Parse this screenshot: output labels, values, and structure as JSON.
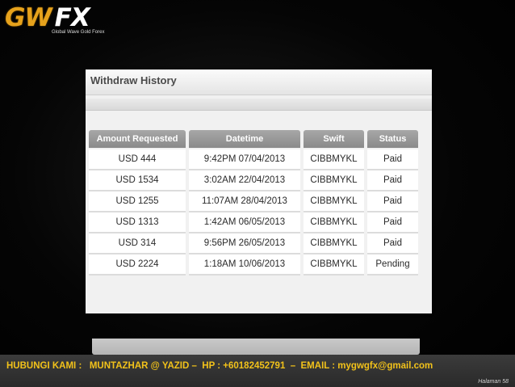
{
  "logo": {
    "brand_left": "GW",
    "brand_right": "FX",
    "tagline": "Global Wave Gold Forex"
  },
  "panel": {
    "title": "Withdraw History"
  },
  "table": {
    "headers": [
      "Amount Requested",
      "Datetime",
      "Swift",
      "Status"
    ],
    "rows": [
      [
        "USD 444",
        "9:42PM 07/04/2013",
        "CIBBMYKL",
        "Paid"
      ],
      [
        "USD 1534",
        "3:02AM 22/04/2013",
        "CIBBMYKL",
        "Paid"
      ],
      [
        "USD 1255",
        "11:07AM 28/04/2013",
        "CIBBMYKL",
        "Paid"
      ],
      [
        "USD 1313",
        "1:42AM 06/05/2013",
        "CIBBMYKL",
        "Paid"
      ],
      [
        "USD 314",
        "9:56PM 26/05/2013",
        "CIBBMYKL",
        "Paid"
      ],
      [
        "USD 2224",
        "1:18AM 10/06/2013",
        "CIBBMYKL",
        "Pending"
      ]
    ]
  },
  "footer": {
    "contact": "HUBUNGI KAMI :   MUNTAZHAR @ YAZID –  HP : +60182452791  –  EMAIL : mygwgfx@gmail.com",
    "page": "Halaman 58"
  },
  "colors": {
    "logo_gold": "#e6a21c",
    "contact_text": "#f2c21a",
    "header_gray": "#999999"
  }
}
